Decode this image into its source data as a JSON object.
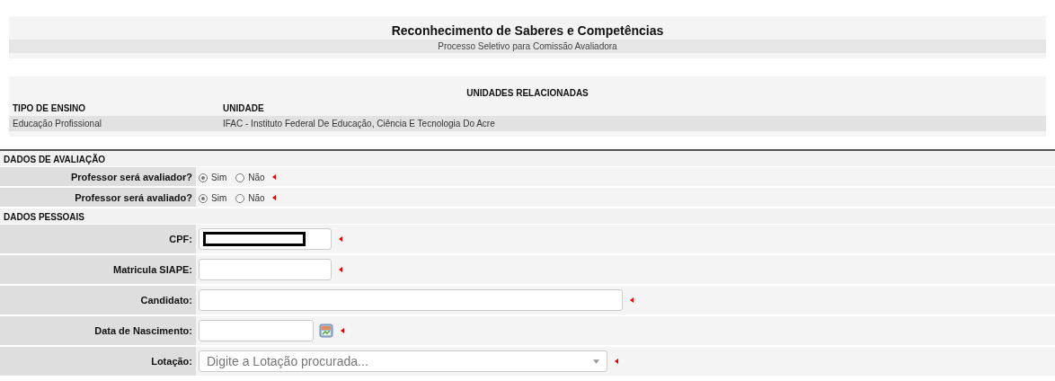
{
  "header": {
    "title": "Reconhecimento de Saberes e Competências",
    "subtitle": "Processo Seletivo para Comissão Avaliadora"
  },
  "units": {
    "title": "UNIDADES RELACIONADAS",
    "columns": [
      "TIPO DE ENSINO",
      "UNIDADE"
    ],
    "rows": [
      [
        "Educação Profissional",
        "IFAC - Instituto Federal De Educação, Ciência E Tecnologia Do Acre"
      ]
    ]
  },
  "sections": [
    {
      "title": "DADOS DE AVALIAÇÃO",
      "fields": [
        {
          "kind": "radio",
          "label": "Professor será avaliador?",
          "options": [
            {
              "label": "Sim",
              "selected": true
            },
            {
              "label": "Não",
              "selected": false
            }
          ],
          "required": true
        },
        {
          "kind": "radio",
          "label": "Professor será avaliado?",
          "options": [
            {
              "label": "Sim",
              "selected": true
            },
            {
              "label": "Não",
              "selected": false
            }
          ],
          "required": true
        }
      ]
    },
    {
      "title": "DADOS PESSOAIS",
      "fields": [
        {
          "kind": "text",
          "label": "CPF:",
          "redacted": true,
          "required": true
        },
        {
          "kind": "text",
          "label": "Matricula SIAPE:",
          "required": true
        },
        {
          "kind": "wide-text",
          "label": "Candidato:",
          "required": true
        },
        {
          "kind": "date",
          "label": "Data de Nascimento:",
          "required": true
        },
        {
          "kind": "select",
          "label": "Lotação:",
          "placeholder": "Digite a Lotação procurada...",
          "required": true
        }
      ]
    }
  ]
}
